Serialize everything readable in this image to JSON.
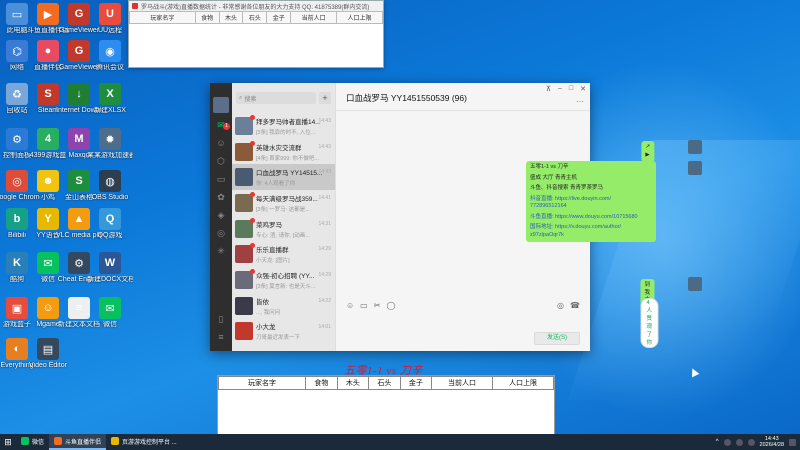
{
  "desktop": {
    "icons": [
      {
        "label": "此电脑",
        "color": "#4a90d9",
        "glyph": "▭"
      },
      {
        "label": "斗鱼直播伴侣",
        "color": "#f26b21",
        "glyph": "▶"
      },
      {
        "label": "GameViewer",
        "color": "#c0392b",
        "glyph": "G"
      },
      {
        "label": "UU远程",
        "color": "#e74c3c",
        "glyph": "U"
      },
      {
        "label": "网络",
        "color": "#3a7bd5",
        "glyph": "⌬"
      },
      {
        "label": "直播伴侣",
        "color": "#e84a5f",
        "glyph": "●"
      },
      {
        "label": "GameViewer",
        "color": "#c0392b",
        "glyph": "G"
      },
      {
        "label": "腾讯会议",
        "color": "#2d8cf0",
        "glyph": "◉"
      },
      {
        "label": "回收站",
        "color": "#7aa7d9",
        "glyph": "♻"
      },
      {
        "label": "Steam",
        "color": "#c0392b",
        "glyph": "S"
      },
      {
        "label": "Internet Downlo...",
        "color": "#1e7e34",
        "glyph": "↓"
      },
      {
        "label": "新建XLSX",
        "color": "#1e8e3e",
        "glyph": "X"
      },
      {
        "label": "控制面板",
        "color": "#2b7bd6",
        "glyph": "⚙"
      },
      {
        "label": "4399游戏盒",
        "color": "#27ae60",
        "glyph": "4"
      },
      {
        "label": "Maxqo",
        "color": "#8e44ad",
        "glyph": "M"
      },
      {
        "label": "某某游戏加速器",
        "color": "#4e6d8c",
        "glyph": "✹"
      },
      {
        "label": "Google Chrome",
        "color": "#dd4b39",
        "glyph": "◎"
      },
      {
        "label": "小鸡",
        "color": "#f1c40f",
        "glyph": "☻"
      },
      {
        "label": "金山表格",
        "color": "#1e8e3e",
        "glyph": "S"
      },
      {
        "label": "OBS Studio",
        "color": "#2c3e50",
        "glyph": "◍"
      },
      {
        "label": "Bilibili",
        "color": "#16a085",
        "glyph": "b"
      },
      {
        "label": "YY语音",
        "color": "#e6b800",
        "glyph": "Y"
      },
      {
        "label": "VLC media player",
        "color": "#f39c12",
        "glyph": "▲"
      },
      {
        "label": "QQ游戏",
        "color": "#3498db",
        "glyph": "Q"
      },
      {
        "label": "酷狗",
        "color": "#2980b9",
        "glyph": "K"
      },
      {
        "label": "微信",
        "color": "#07c160",
        "glyph": "✉"
      },
      {
        "label": "Cheat Engine",
        "color": "#34495e",
        "glyph": "⚙"
      },
      {
        "label": "新建DOCX文档",
        "color": "#2b5797",
        "glyph": "W"
      },
      {
        "label": "游戏盒子",
        "color": "#e74c3c",
        "glyph": "▣"
      },
      {
        "label": "Mgame",
        "color": "#f39c12",
        "glyph": "☺"
      },
      {
        "label": "新建文本文档",
        "color": "#ecf0f1",
        "glyph": "≡"
      },
      {
        "label": "微信",
        "color": "#07c160",
        "glyph": "✉"
      },
      {
        "label": "Everything",
        "color": "#e67e22",
        "glyph": "◐"
      },
      {
        "label": "Video Editor",
        "color": "#34495e",
        "glyph": "▤"
      }
    ]
  },
  "top_window": {
    "title": "罗马战斗(游戏)直播数据统计 - 非常感谢各位朋友的大力支持 QQ: 41875389(群内交流)",
    "columns": [
      "玩家名字",
      "食物",
      "木头",
      "石头",
      "金子",
      "当前人口",
      "人口上限"
    ]
  },
  "chat": {
    "search_placeholder": "搜索",
    "plus": "+",
    "unread_badge": "1",
    "conversations": [
      {
        "name": "拜多罗马帅者直播14...",
        "preview": "[3条] 我靠的时不, 入位...",
        "time": "14:43",
        "color": "#6b7f99",
        "unread": true
      },
      {
        "name": "英雄水灾交流群",
        "preview": "[4条] 首家999: 你不做吧...",
        "time": "14:43",
        "color": "#8a5a3a",
        "unread": true
      },
      {
        "name": "口血战罗马 YY14515...",
        "preview": "你: 4人观看了你",
        "time": "14:43",
        "color": "#4a5a70",
        "unread": false
      },
      {
        "name": "每天满级罗马战359...",
        "preview": "[3条] 一罗马: 这都是...",
        "time": "14:41",
        "color": "#7a6a50",
        "unread": true
      },
      {
        "name": "菜鸡罗马",
        "preview": "专心: 渣, 请你, [动画...",
        "time": "14:31",
        "color": "#5a7a5a",
        "unread": true
      },
      {
        "name": "乐乐直播群",
        "preview": "小天龙: [图片]",
        "time": "14:29",
        "color": "#a04040",
        "unread": true
      },
      {
        "name": "众强-初心招聘 (YY...",
        "preview": "[3条] 莫言新: 也是天斗...",
        "time": "14:29",
        "color": "#6a6a7a",
        "unread": true
      },
      {
        "name": "皆依",
        "preview": "..., 我问问",
        "time": "14:22",
        "color": "#3a3a4a",
        "unread": false
      },
      {
        "name": "小大龙",
        "preview": "刀哥最近发表一下",
        "time": "14:01",
        "color": "#c0392b",
        "unread": false
      }
    ],
    "header_title": "口血战罗马 YY1451550539 (96)",
    "messages": {
      "small": "↗ ▶",
      "main_lines": [
        {
          "text": "五零1-1 vs 刀辛",
          "link": false
        },
        {
          "text": "盛成 大厅 青青主机",
          "link": false
        },
        {
          "text": "斗鱼、抖音搜索 青青罗茶罗马",
          "link": false
        },
        {
          "text": "抖音直播: https://live.douyin.com/",
          "link": true
        },
        {
          "text": "772896512164",
          "link": true
        },
        {
          "text": "斗鱼直播: https://www.douyu.com/10715680",
          "link": true
        },
        {
          "text": "国际地址: https://v.douyu.com/author/",
          "link": true
        },
        {
          "text": "z97zlpaOqr7k",
          "link": true
        }
      ],
      "reply": "到我大厅",
      "chip": "4人赞观了你"
    },
    "toolbar": [
      "☺",
      "▭",
      "✂",
      "◯"
    ],
    "toolbar_right": [
      "◎",
      "☎"
    ],
    "send_label": "发送(S)"
  },
  "overlay": {
    "red_title": "五零1-1 vs 刀辛"
  },
  "bottom_window": {
    "columns": [
      "玩家名字",
      "食物",
      "木头",
      "石头",
      "金子",
      "当前人口",
      "人口上限"
    ]
  },
  "taskbar": {
    "start": "⊞",
    "apps": [
      {
        "label": "微信",
        "color": "#07c160",
        "active": false
      },
      {
        "label": "斗鱼直播伴侣",
        "color": "#f26b21",
        "active": true
      },
      {
        "label": "页游游戏控制平台 ...",
        "color": "#e6b800",
        "active": false
      }
    ],
    "time": "14:43",
    "date": "2026/4/28",
    "tray_text": "^"
  }
}
